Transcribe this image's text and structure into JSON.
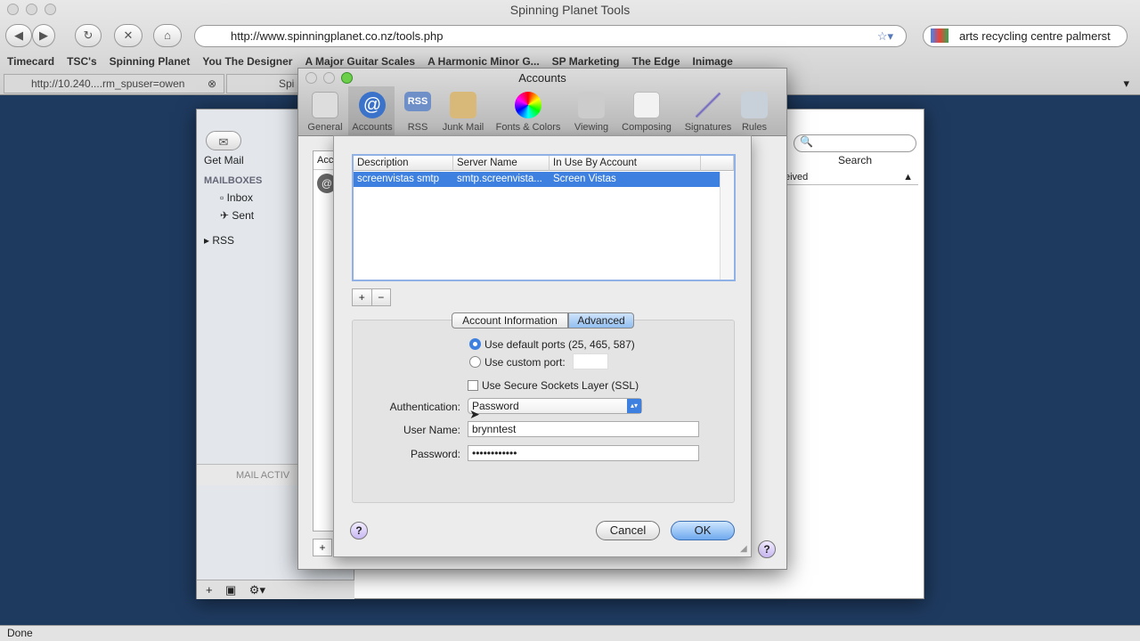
{
  "browser": {
    "title": "Spinning Planet Tools",
    "url": "http://www.spinningplanet.co.nz/tools.php",
    "search": "arts recycling centre palmerst",
    "bookmarks": [
      "Timecard",
      "TSC's",
      "Spinning Planet",
      "You The Designer",
      "A Major Guitar Scales",
      "A Harmonic Minor G...",
      "SP Marketing",
      "The Edge",
      "Inimage"
    ],
    "tabs": [
      "http://10.240....rm_spuser=owen",
      "Spi"
    ],
    "status": "Done"
  },
  "mail": {
    "get_mail": "Get Mail",
    "mailboxes": "MAILBOXES",
    "inbox": "Inbox",
    "sent": "Sent",
    "rss": "RSS",
    "search_label": "Search",
    "activity": "MAIL ACTIV",
    "received_col": "eived",
    "acc_col": "Acc"
  },
  "prefs": {
    "title": "Accounts",
    "toolbar": [
      "General",
      "Accounts",
      "RSS",
      "Junk Mail",
      "Fonts & Colors",
      "Viewing",
      "Composing",
      "Signatures",
      "Rules"
    ],
    "active": "Accounts"
  },
  "sheet": {
    "columns": [
      "Description",
      "Server Name",
      "In Use By Account"
    ],
    "rows": [
      [
        "screenvistas smtp",
        "smtp.screenvista...",
        "Screen Vistas"
      ]
    ],
    "tabs": [
      "Account Information",
      "Advanced"
    ],
    "active_tab": "Advanced",
    "default_ports": "Use default ports (25, 465, 587)",
    "custom_port": "Use custom port:",
    "port_mode": "default",
    "custom_port_value": "",
    "ssl": "Use Secure Sockets Layer (SSL)",
    "ssl_checked": false,
    "auth_label": "Authentication:",
    "auth_value": "Password",
    "user_label": "User Name:",
    "user_value": "brynntest",
    "pass_label": "Password:",
    "pass_value": "••••••••••••",
    "cancel": "Cancel",
    "ok": "OK",
    "help": "?",
    "add": "+",
    "remove": "−"
  },
  "colors": {
    "selection": "#3d80df",
    "desktop": "#1e3a5f",
    "ok_button": "#7fb4f0"
  }
}
